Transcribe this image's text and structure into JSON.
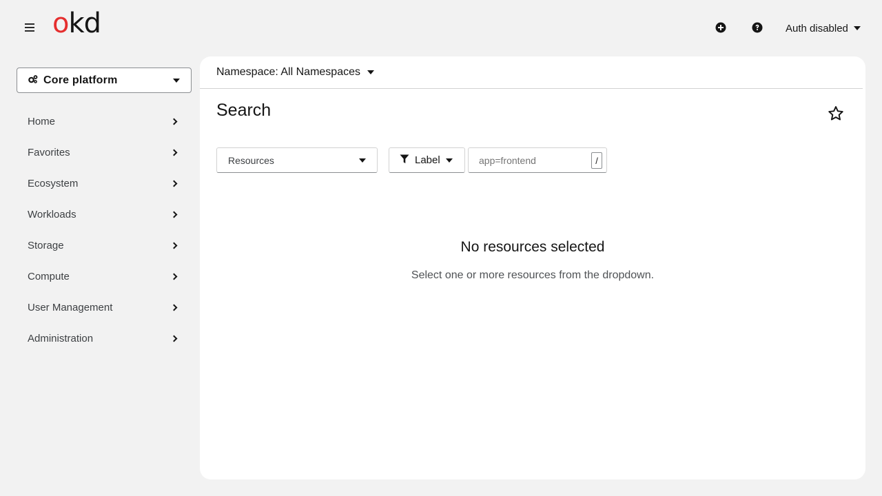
{
  "header": {
    "logo_o": "o",
    "logo_kd": "kd",
    "user_label": "Auth disabled",
    "icons": [
      "menu-icon",
      "add-icon",
      "help-icon",
      "caret-down-icon"
    ]
  },
  "sidebar": {
    "perspective_label": "Core platform",
    "items": [
      {
        "label": "Home"
      },
      {
        "label": "Favorites"
      },
      {
        "label": "Ecosystem"
      },
      {
        "label": "Workloads"
      },
      {
        "label": "Storage"
      },
      {
        "label": "Compute"
      },
      {
        "label": "User Management"
      },
      {
        "label": "Administration"
      }
    ]
  },
  "main": {
    "namespace_label": "Namespace: All Namespaces",
    "title": "Search",
    "resources_placeholder": "Resources",
    "filter_label": "Label",
    "label_input_placeholder": "app=frontend",
    "kbd_hint": "/",
    "empty_title": "No resources selected",
    "empty_body": "Select one or more resources from the dropdown."
  },
  "colors": {
    "brand_red": "#e52e2e",
    "background": "#f2f2f2",
    "panel": "#ffffff",
    "border": "#d2d2d2"
  }
}
